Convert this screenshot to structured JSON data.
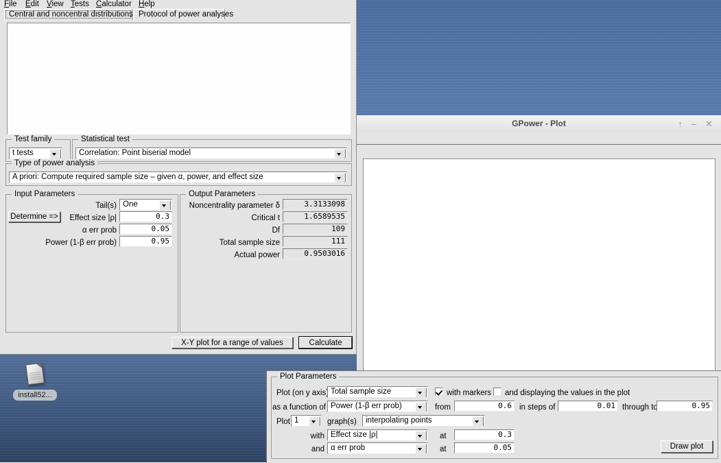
{
  "desktop": {
    "icon": {
      "label": "install52...",
      "icon": "document-icon"
    }
  },
  "main_window": {
    "menu": [
      {
        "label": "File",
        "mnemonic": "F"
      },
      {
        "label": "Edit",
        "mnemonic": "E"
      },
      {
        "label": "View",
        "mnemonic": "V"
      },
      {
        "label": "Tests",
        "mnemonic": "T"
      },
      {
        "label": "Calculator",
        "mnemonic": "C"
      },
      {
        "label": "Help",
        "mnemonic": "H"
      }
    ],
    "tabs": [
      {
        "label": "Central and noncentral distributions",
        "selected": true
      },
      {
        "label": "Protocol of power analyses",
        "selected": false
      }
    ],
    "test_family": {
      "group_title": "Test family",
      "value": "t tests"
    },
    "statistical_test": {
      "group_title": "Statistical test",
      "value": "Correlation: Point biserial model"
    },
    "type_of_power_analysis": {
      "group_title": "Type of power analysis",
      "value": "A priori: Compute required sample size – given α, power, and effect size"
    },
    "input_parameters": {
      "group_title": "Input Parameters",
      "determine_button": "Determine =>",
      "rows": [
        {
          "label": "Tail(s)",
          "value": "One",
          "type": "combo"
        },
        {
          "label": "Effect size |ρ|",
          "value": "0.3",
          "type": "field"
        },
        {
          "label": "α err prob",
          "value": "0.05",
          "type": "field"
        },
        {
          "label": "Power (1-β err prob)",
          "value": "0.95",
          "type": "field"
        }
      ]
    },
    "output_parameters": {
      "group_title": "Output Parameters",
      "rows": [
        {
          "label": "Noncentrality parameter δ",
          "value": "3.3133098"
        },
        {
          "label": "Critical t",
          "value": "1.6589535"
        },
        {
          "label": "Df",
          "value": "109"
        },
        {
          "label": "Total sample size",
          "value": "111"
        },
        {
          "label": "Actual power",
          "value": "0.9503016"
        }
      ]
    },
    "buttons": {
      "xy_plot": "X-Y plot for a range of values",
      "calculate": "Calculate"
    }
  },
  "plot_window": {
    "title": "GPower - Plot",
    "controls": {
      "maximize": "↑",
      "minimize": "–",
      "close": "✕"
    }
  },
  "plot_parameters": {
    "group_title": "Plot Parameters",
    "plot_y_axis": {
      "label": "Plot (on y axis)",
      "value": "Total sample size"
    },
    "as_a_function_of": {
      "label": "as a function of",
      "value": "Power (1-β err prob)"
    },
    "with_markers": {
      "label": "with markers",
      "checked": true
    },
    "display_values": {
      "label": "and displaying the values in the plot",
      "checked": false
    },
    "range": {
      "from_label": "from",
      "from_value": "0.6",
      "steps_label": "in steps of",
      "steps_value": "0.01",
      "through_label": "through to",
      "through_value": "0.95"
    },
    "plot_count": {
      "label": "Plot",
      "value": "1",
      "suffix": "graph(s)"
    },
    "graph_style": {
      "value": "interpolating points"
    },
    "with_param": {
      "label": "with",
      "value": "Effect size |ρ|",
      "at_label": "at",
      "at_value": "0.3"
    },
    "and_param": {
      "label": "and",
      "value": "α err prob",
      "at_label": "at",
      "at_value": "0.05"
    },
    "draw_button": "Draw plot"
  }
}
